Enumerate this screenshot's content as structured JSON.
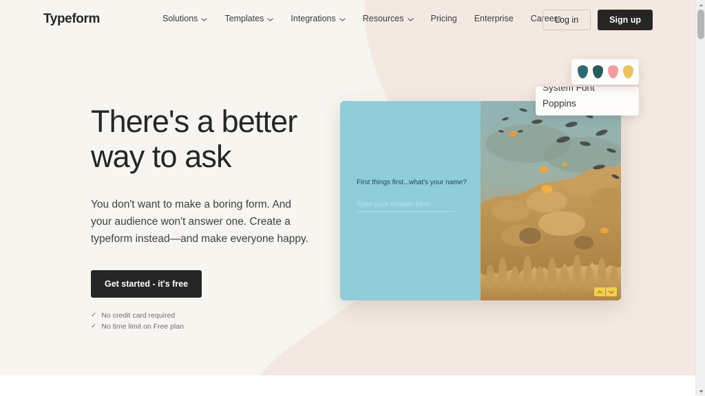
{
  "brand": {
    "logo_text": "Typeform",
    "accent_dark": "#262627",
    "page_bg_left": "#f7f5f0",
    "page_bg_right": "#f4e9e2"
  },
  "nav": {
    "items": [
      {
        "label": "Solutions",
        "has_dropdown": true,
        "icon": "chevron-down-icon"
      },
      {
        "label": "Templates",
        "has_dropdown": true,
        "icon": "chevron-down-icon"
      },
      {
        "label": "Integrations",
        "has_dropdown": true,
        "icon": "chevron-down-icon"
      },
      {
        "label": "Resources",
        "has_dropdown": true,
        "icon": "chevron-down-icon"
      },
      {
        "label": "Pricing",
        "has_dropdown": false,
        "icon": ""
      },
      {
        "label": "Enterprise",
        "has_dropdown": false,
        "icon": ""
      },
      {
        "label": "Careers",
        "has_dropdown": false,
        "icon": ""
      }
    ]
  },
  "auth": {
    "login_label": "Log in",
    "signup_label": "Sign up"
  },
  "hero": {
    "heading_line_1": "There's a better",
    "heading_line_2": "way to ask",
    "subheading": "You don't want to make a boring form. And your audience won't answer one. Create a typeform instead—and make everyone happy.",
    "cta_label": "Get started - it's free",
    "perks": [
      {
        "tick": "✓",
        "label": "No credit card required"
      },
      {
        "tick": "✓",
        "label": "No time limit on Free plan"
      }
    ]
  },
  "preview_card": {
    "question": "First things first...what's your name?",
    "answer_placeholder": "Type your answer here...",
    "panel_color": "#8fcdd9",
    "question_color": "#1f4450",
    "nav_buttons": [
      {
        "icon": "chevron-up-icon",
        "name": "previous-question-button"
      },
      {
        "icon": "chevron-down-icon",
        "name": "next-question-button"
      }
    ],
    "nav_button_color": "#f2ce4e",
    "image_alt": "coral-reef-photo"
  },
  "palette_popover": {
    "swatches": [
      {
        "name": "swatch-teal-dark",
        "color": "#2e6873"
      },
      {
        "name": "swatch-teal-deep",
        "color": "#2a5a59"
      },
      {
        "name": "swatch-coral-pink",
        "color": "#f59ba0"
      },
      {
        "name": "swatch-gold",
        "color": "#eac362"
      }
    ]
  },
  "font_popover": {
    "options": [
      {
        "label": "System Font",
        "selected": false
      },
      {
        "label": "Poppins",
        "selected": true
      }
    ]
  },
  "scrollbar": {
    "up_arrow_icon": "scroll-up-arrow-icon",
    "down_arrow_icon": "scroll-down-arrow-icon",
    "thumb_name": "scrollbar-thumb"
  }
}
